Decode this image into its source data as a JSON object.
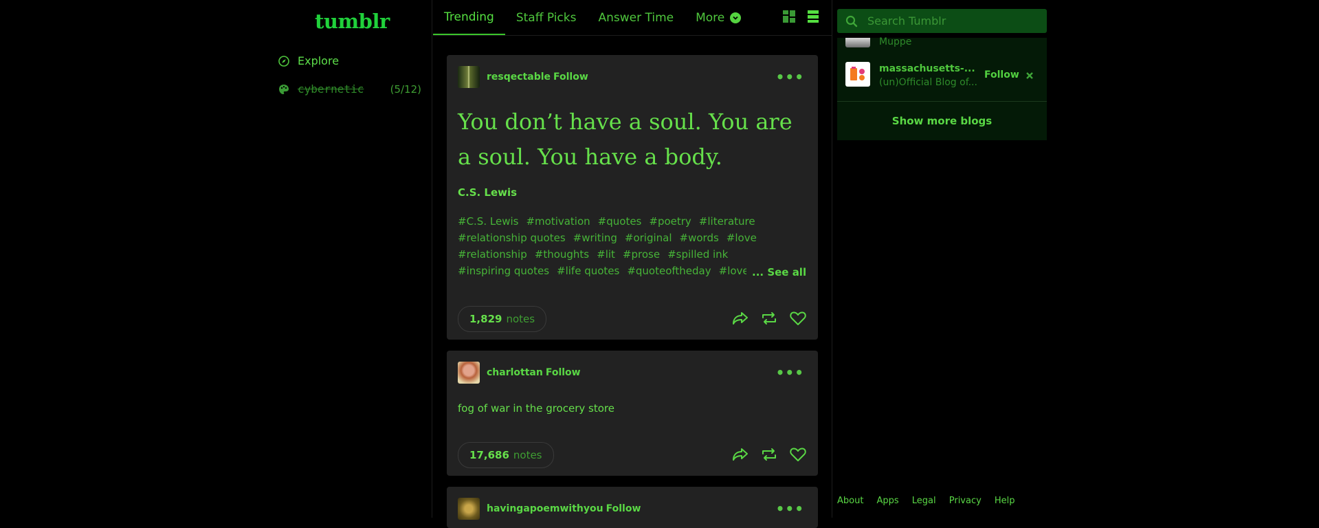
{
  "brand": {
    "logo": "tumblr"
  },
  "sidebar": {
    "items": [
      {
        "label": "Explore",
        "icon": "compass-icon"
      },
      {
        "label": "cybernetic",
        "icon": "palette-icon",
        "count": "(5/12)"
      }
    ]
  },
  "tabs": [
    {
      "label": "Trending",
      "active": true
    },
    {
      "label": "Staff Picks"
    },
    {
      "label": "Answer Time"
    },
    {
      "label": "More"
    }
  ],
  "search": {
    "placeholder": "Search Tumblr"
  },
  "posts": [
    {
      "blog": "resqectable",
      "follow_label": "Follow",
      "quote": "You don’t have a soul. You are a soul. You have a body.",
      "source": "C.S. Lewis",
      "tags": [
        [
          "#C.S. Lewis",
          "#motivation",
          "#quotes",
          "#poetry",
          "#literature"
        ],
        [
          "#relationship quotes",
          "#writing",
          "#original",
          "#words",
          "#love"
        ],
        [
          "#relationship",
          "#thoughts",
          "#lit",
          "#prose",
          "#spilled ink"
        ],
        [
          "#inspiring quotes",
          "#life quotes",
          "#quoteoftheday",
          "#love q"
        ]
      ],
      "see_all": "... See all",
      "notes_count": "1,829",
      "notes_label": "notes"
    },
    {
      "blog": "charlottan",
      "follow_label": "Follow",
      "text": "fog of war in the grocery store",
      "notes_count": "17,686",
      "notes_label": "notes"
    },
    {
      "blog": "havingapoemwithyou",
      "follow_label": "Follow"
    }
  ],
  "recommended": {
    "partial_desc": "Muppe",
    "blog": {
      "name": "massachusetts-...",
      "desc": "(un)Official Blog of...",
      "follow_label": "Follow"
    },
    "show_more": "Show more blogs"
  },
  "footer": [
    "About",
    "Apps",
    "Legal",
    "Privacy",
    "Help"
  ],
  "colors": {
    "accent": "#55e041",
    "card": "#222222",
    "search_bg": "#0c4d15"
  }
}
